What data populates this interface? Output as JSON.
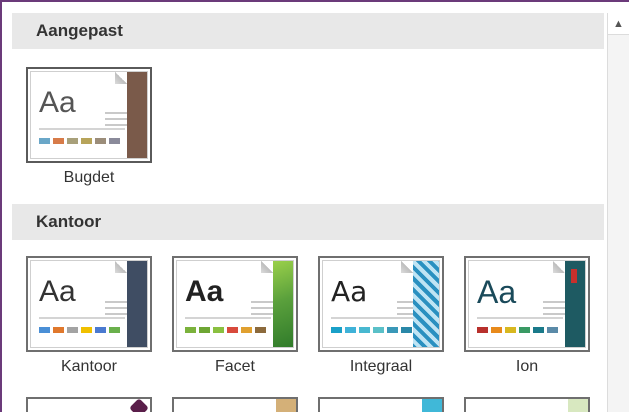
{
  "sections": [
    {
      "header": "Aangepast",
      "themes": [
        {
          "label": "Bugdet",
          "aa": "Aa",
          "aa_color": "#4a4a4a",
          "strip_color": "#7a5a4a",
          "swatches": [
            "#6aa7c8",
            "#d77b49",
            "#a8a07a",
            "#b7a45a",
            "#9b8d7a",
            "#8a8a9a"
          ]
        }
      ]
    },
    {
      "header": "Kantoor",
      "themes": [
        {
          "label": "Kantoor",
          "aa": "Aa",
          "aa_color": "#222",
          "strip_color": "#3f4d63",
          "swatches": [
            "#4a8fd6",
            "#e0782c",
            "#a3a3a3",
            "#f0c000",
            "#4a7ad0",
            "#6ab04c"
          ]
        },
        {
          "label": "Facet",
          "aa": "Aa",
          "aa_color": "#222",
          "strip_color": "#5aa03c",
          "swatches": [
            "#7bb23c",
            "#6ea634",
            "#8ac040",
            "#d84a3c",
            "#e0a030",
            "#8c6a3c"
          ]
        },
        {
          "label": "Integraal",
          "aa": "Aa",
          "aa_color": "#222",
          "strip_color": "#3a9ec8",
          "swatches": [
            "#1aa0c8",
            "#3fb2d8",
            "#48b8d0",
            "#5ac0c8",
            "#3a98b8",
            "#2a88a8"
          ]
        },
        {
          "label": "Ion",
          "aa": "Aa",
          "aa_color": "#1a4a5a",
          "strip_color": "#1e5a62",
          "swatches": [
            "#b8302c",
            "#e88a1c",
            "#d8b820",
            "#3a9a64",
            "#1a7a8a",
            "#5a8aa8"
          ]
        }
      ]
    }
  ],
  "partial_row": [
    {
      "strip_color": "#5a1e4a"
    },
    {
      "strip_color": "#d4b078"
    },
    {
      "strip_color": "#40b8d8"
    },
    {
      "strip_color": "#d8e8c0"
    }
  ],
  "scrollbar": {
    "up_icon": "▲"
  }
}
